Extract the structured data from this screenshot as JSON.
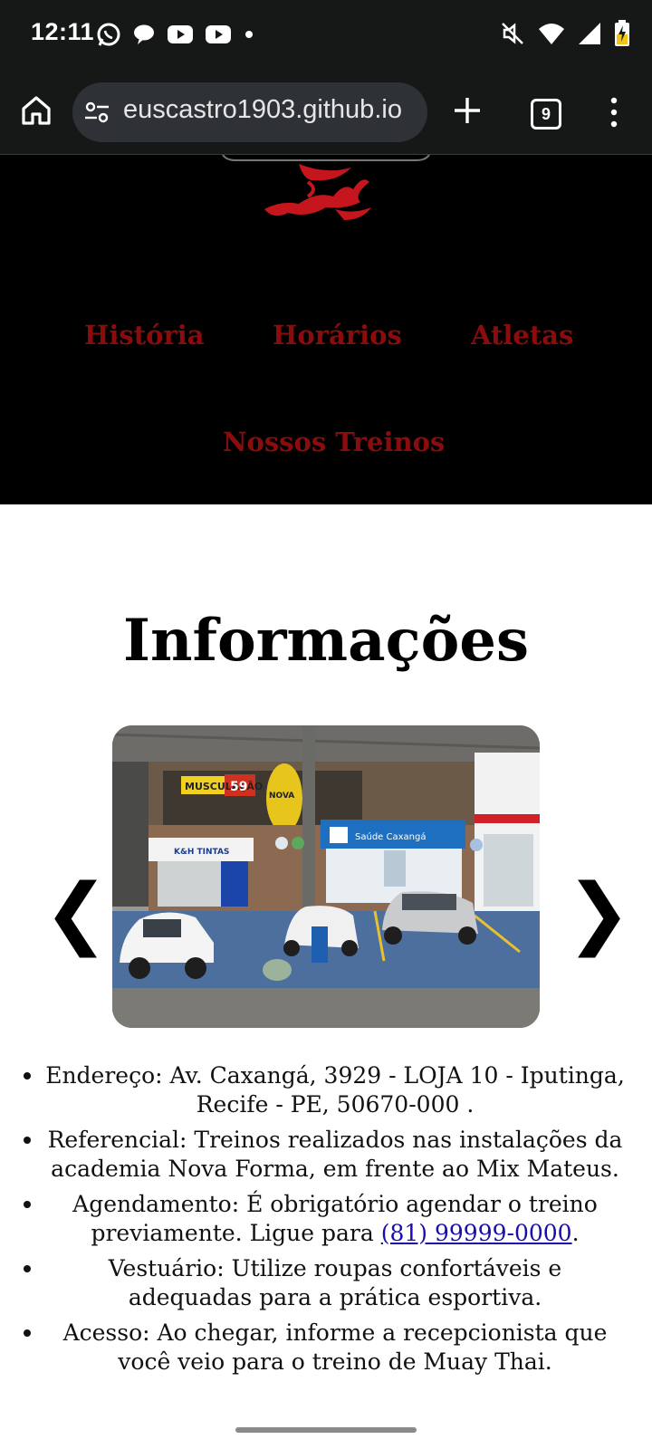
{
  "status_bar": {
    "time": "12:11",
    "left_icons": [
      "whatsapp-icon",
      "chat-bubble-icon",
      "youtube-icon",
      "youtube-icon",
      "dot-icon"
    ],
    "right_icons": [
      "mute-icon",
      "wifi-icon",
      "signal-icon",
      "battery-charging-icon"
    ]
  },
  "browser": {
    "url": "euscastro1903.github.io",
    "tab_count": "9"
  },
  "nav": {
    "items": [
      "História",
      "Horários",
      "Atletas",
      "Nossos Treinos"
    ],
    "link_color": "#8b0c0c"
  },
  "page": {
    "title": "Informações",
    "carousel_prev": "❮",
    "carousel_next": "❯",
    "info": [
      {
        "text": "Endereço: Av. Caxangá, 3929 - LOJA 10 - Iputinga, Recife - PE, 50670-000 ."
      },
      {
        "text": "Referencial: Treinos realizados nas instalações da academia Nova Forma, em frente ao Mix Mateus."
      },
      {
        "text_before": "Agendamento: É obrigatório agendar o treino previamente. Ligue para ",
        "link": "(81) 99999-0000",
        "text_after": "."
      },
      {
        "text": "Vestuário: Utilize roupas confortáveis e adequadas para a prática esportiva."
      },
      {
        "text": "Acesso: Ao chegar, informe a recepcionista que você veio para o treino de Muay Thai."
      }
    ]
  },
  "photo_signs": {
    "musculacao": "MUSCULAÇÃO",
    "price": "59",
    "tintas": "K&H TINTAS",
    "saude": "Saúde Caxangá",
    "academia": "NOVA"
  }
}
